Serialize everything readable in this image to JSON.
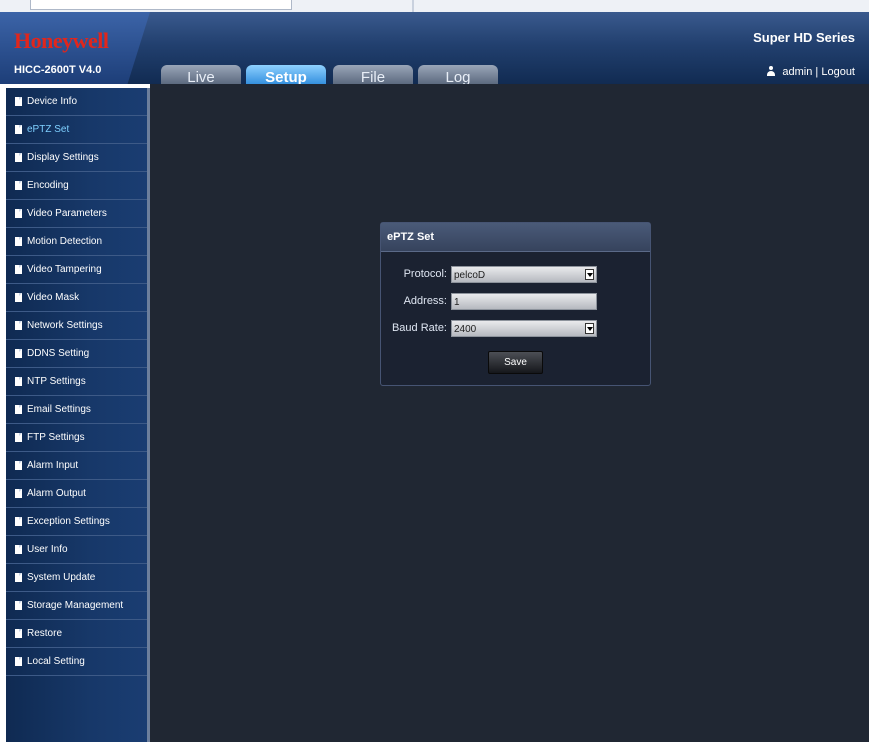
{
  "header": {
    "logo": "Honeywell",
    "model": "HICC-2600T  V4.0",
    "brand": "Super HD Series",
    "user": "admin",
    "separator": "|",
    "logout": "Logout"
  },
  "tabs": [
    {
      "label": "Live",
      "active": false
    },
    {
      "label": "Setup",
      "active": true
    },
    {
      "label": "File",
      "active": false
    },
    {
      "label": "Log",
      "active": false
    }
  ],
  "sidebar": {
    "items": [
      {
        "label": "Device Info"
      },
      {
        "label": "ePTZ Set",
        "active": true
      },
      {
        "label": "Display Settings"
      },
      {
        "label": "Encoding"
      },
      {
        "label": "Video Parameters"
      },
      {
        "label": "Motion Detection"
      },
      {
        "label": "Video Tampering"
      },
      {
        "label": "Video Mask"
      },
      {
        "label": "Network Settings"
      },
      {
        "label": "DDNS Setting"
      },
      {
        "label": "NTP Settings"
      },
      {
        "label": "Email Settings"
      },
      {
        "label": "FTP Settings"
      },
      {
        "label": "Alarm Input"
      },
      {
        "label": "Alarm Output"
      },
      {
        "label": "Exception Settings"
      },
      {
        "label": "User Info"
      },
      {
        "label": "System Update"
      },
      {
        "label": "Storage Management"
      },
      {
        "label": "Restore"
      },
      {
        "label": "Local Setting"
      }
    ]
  },
  "panel": {
    "title": "ePTZ Set",
    "protocol_label": "Protocol:",
    "protocol_value": "pelcoD",
    "address_label": "Address:",
    "address_value": "1",
    "baud_label": "Baud Rate:",
    "baud_value": "2400",
    "save_label": "Save"
  },
  "colors": {
    "accent": "#1e7fd6",
    "logo": "#e1261c",
    "active_menu": "#7fd0ff",
    "content_bg": "#202733"
  },
  "icons": {
    "menu_item": "document-icon",
    "user": "user-icon",
    "dropdown": "dropdown-arrow-icon"
  }
}
